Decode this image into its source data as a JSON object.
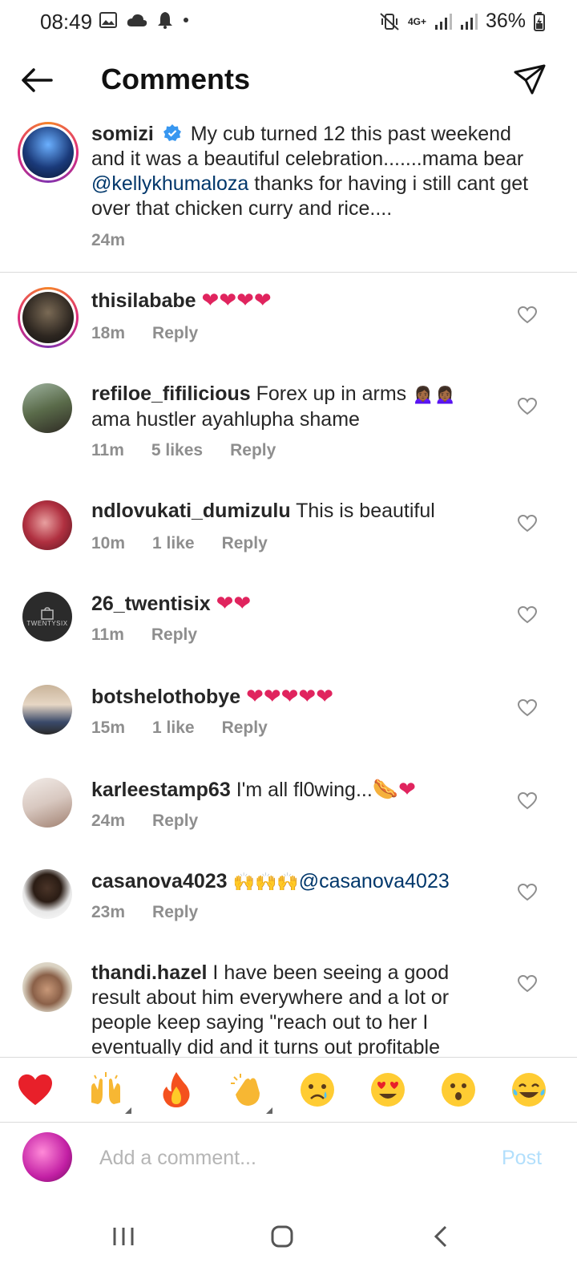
{
  "status_bar": {
    "time": "08:49",
    "battery": "36%",
    "network": "4G+"
  },
  "header": {
    "title": "Comments"
  },
  "caption": {
    "username": "somizi",
    "text_before": "My cub turned 12 this past weekend and it was a beautiful celebration.......mama bear ",
    "mention": "@kellykhumaloza",
    "text_after": " thanks for having i still cant get over that chicken curry and rice....",
    "time": "24m"
  },
  "comments": [
    {
      "username": "thisilababe",
      "text": "",
      "emojis": "❤❤❤❤",
      "time": "18m",
      "likes": "",
      "reply": "Reply"
    },
    {
      "username": "refiloe_fifilicious",
      "text": "Forex up in arms",
      "emojis": "🙍🏾‍♀️🙍🏾‍♀️",
      "text2": "ama hustler ayahlupha shame",
      "time": "11m",
      "likes": "5 likes",
      "reply": "Reply"
    },
    {
      "username": "ndlovukati_dumizulu",
      "text": "This is beautiful",
      "emojis": "",
      "time": "10m",
      "likes": "1 like",
      "reply": "Reply"
    },
    {
      "username": "26_twentisix",
      "text": "",
      "emojis": "❤❤",
      "time": "11m",
      "likes": "",
      "reply": "Reply",
      "avatar_text": "TWENTYSIX"
    },
    {
      "username": "botshelothobye",
      "text": "",
      "emojis": "❤❤❤❤❤",
      "time": "15m",
      "likes": "1 like",
      "reply": "Reply"
    },
    {
      "username": "karleestamp63",
      "text": "I'm all fl0wing...",
      "emojis": "🌭❤",
      "time": "24m",
      "likes": "",
      "reply": "Reply"
    },
    {
      "username": "casanova4023",
      "text": "",
      "emojis": "🙌🙌🙌",
      "mention": "@casanova4023",
      "time": "23m",
      "likes": "",
      "reply": "Reply"
    },
    {
      "username": "thandi.hazel",
      "text": "I have been seeing a good result about him everywhere and a lot or people keep saying \"reach out to her I eventually did and it turns out profitable",
      "emojis": "",
      "time": "",
      "likes": "",
      "reply": ""
    }
  ],
  "emoji_bar": [
    {
      "icon": "red-heart",
      "glyph": "❤️"
    },
    {
      "icon": "raising-hands",
      "glyph": "🙌"
    },
    {
      "icon": "fire",
      "glyph": "🔥"
    },
    {
      "icon": "clapping-hands",
      "glyph": "👏"
    },
    {
      "icon": "crying-face",
      "glyph": "😢"
    },
    {
      "icon": "heart-eyes",
      "glyph": "😍"
    },
    {
      "icon": "surprised-face",
      "glyph": "😮"
    },
    {
      "icon": "tears-of-joy",
      "glyph": "😂"
    }
  ],
  "comment_input": {
    "placeholder": "Add a comment...",
    "post_label": "Post"
  },
  "colors": {
    "link": "#00376b",
    "post_disabled": "#b2dffc",
    "gray_text": "#8e8e8e",
    "verified": "#3897f0"
  }
}
